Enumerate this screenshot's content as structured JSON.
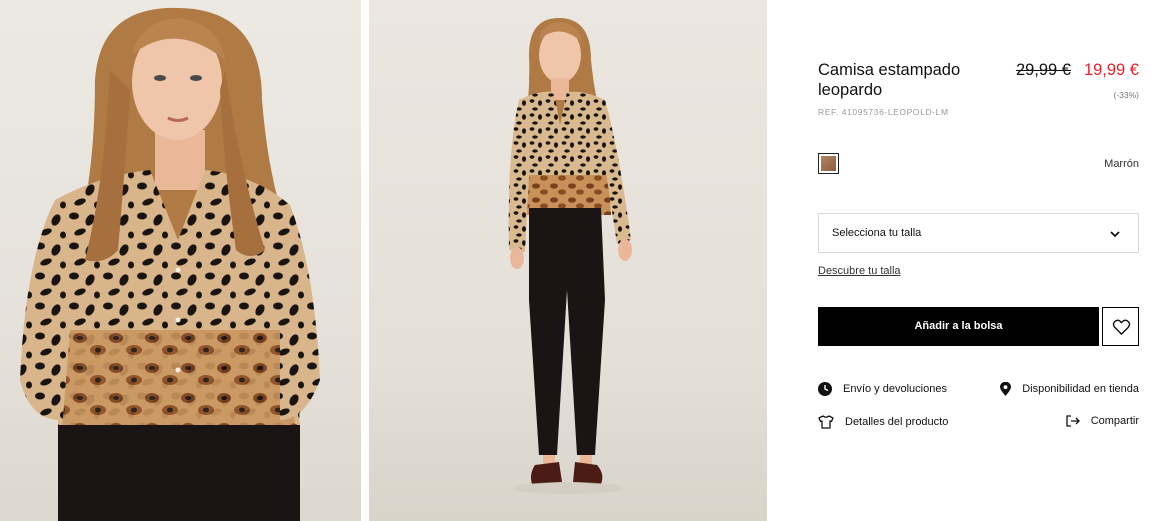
{
  "images": [
    {
      "alt": "product-photo-front-closeup"
    },
    {
      "alt": "product-photo-full-body"
    }
  ],
  "product": {
    "title": "Camisa estampado leopardo",
    "price_old": "29,99 €",
    "price_new": "19,99 €",
    "discount": "(-33%)",
    "reference": "REF. 41095736-LEOPOLD-LM",
    "color_name": "Marrón"
  },
  "size": {
    "select_label": "Selecciona tu talla",
    "guide_link": "Descubre tu talla"
  },
  "actions": {
    "add_to_bag": "Añadir a la bolsa",
    "shipping": "Envío y devoluciones",
    "store_availability": "Disponibilidad en tienda",
    "product_details": "Detalles del producto",
    "share": "Compartir"
  },
  "colors": {
    "sale_red": "#e2232a",
    "button_black": "#000000",
    "swatch_brown": "#a27352"
  },
  "icons": [
    "chevron-down-icon",
    "heart-icon",
    "clock-icon",
    "location-pin-icon",
    "shirt-icon",
    "share-icon"
  ]
}
